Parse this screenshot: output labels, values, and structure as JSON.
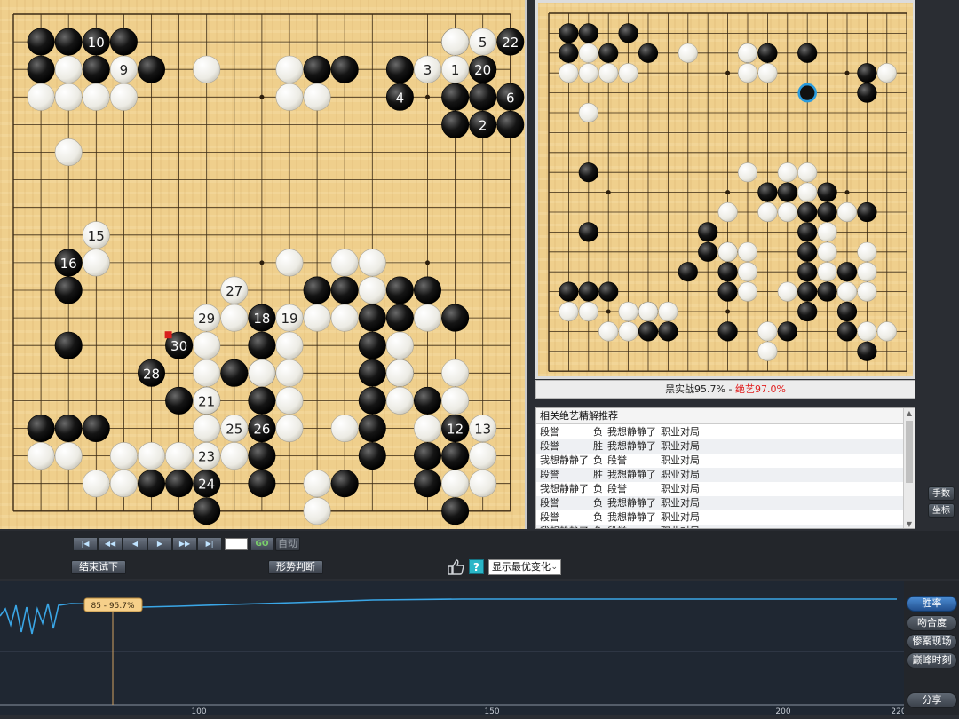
{
  "main_board": {
    "black": [
      [
        1,
        1
      ],
      [
        2,
        1
      ],
      [
        4,
        1
      ],
      [
        1,
        2
      ],
      [
        3,
        2
      ],
      [
        5,
        2
      ],
      [
        14,
        2
      ],
      [
        11,
        2
      ],
      [
        12,
        2
      ],
      [
        16,
        3
      ],
      [
        16,
        4
      ],
      [
        17,
        2
      ],
      [
        16,
        1
      ],
      [
        18,
        4
      ],
      [
        17,
        3
      ],
      [
        2,
        9
      ],
      [
        2,
        10
      ],
      [
        2,
        12
      ],
      [
        11,
        10
      ],
      [
        12,
        10
      ],
      [
        14,
        10
      ],
      [
        15,
        10
      ],
      [
        13,
        11
      ],
      [
        14,
        11
      ],
      [
        16,
        11
      ],
      [
        9,
        12
      ],
      [
        13,
        12
      ],
      [
        8,
        13
      ],
      [
        13,
        13
      ],
      [
        14,
        13
      ],
      [
        6,
        14
      ],
      [
        9,
        13
      ],
      [
        7,
        14
      ],
      [
        9,
        14
      ],
      [
        13,
        14
      ],
      [
        15,
        14
      ],
      [
        1,
        15
      ],
      [
        2,
        15
      ],
      [
        3,
        15
      ],
      [
        9,
        15
      ],
      [
        13,
        15
      ],
      [
        9,
        16
      ],
      [
        13,
        16
      ],
      [
        15,
        16
      ],
      [
        16,
        16
      ],
      [
        9,
        17
      ],
      [
        12,
        17
      ],
      [
        15,
        17
      ],
      [
        5,
        17
      ],
      [
        6,
        17
      ],
      [
        16,
        18
      ],
      [
        7,
        18
      ]
    ],
    "white": [
      [
        2,
        2
      ],
      [
        7,
        2
      ],
      [
        10,
        2
      ],
      [
        15,
        2
      ],
      [
        16,
        1
      ],
      [
        1,
        3
      ],
      [
        2,
        3
      ],
      [
        3,
        3
      ],
      [
        4,
        3
      ],
      [
        10,
        3
      ],
      [
        11,
        3
      ],
      [
        2,
        5
      ],
      [
        3,
        9
      ],
      [
        10,
        9
      ],
      [
        12,
        9
      ],
      [
        13,
        9
      ],
      [
        13,
        10
      ],
      [
        8,
        11
      ],
      [
        9,
        11
      ],
      [
        11,
        11
      ],
      [
        12,
        11
      ],
      [
        15,
        11
      ],
      [
        7,
        12
      ],
      [
        10,
        12
      ],
      [
        14,
        12
      ],
      [
        7,
        13
      ],
      [
        9,
        13
      ],
      [
        10,
        13
      ],
      [
        14,
        13
      ],
      [
        16,
        13
      ],
      [
        10,
        14
      ],
      [
        14,
        14
      ],
      [
        16,
        14
      ],
      [
        7,
        15
      ],
      [
        10,
        15
      ],
      [
        12,
        15
      ],
      [
        15,
        15
      ],
      [
        16,
        15
      ],
      [
        1,
        16
      ],
      [
        2,
        16
      ],
      [
        4,
        16
      ],
      [
        5,
        16
      ],
      [
        6,
        16
      ],
      [
        8,
        16
      ],
      [
        17,
        16
      ],
      [
        3,
        17
      ],
      [
        4,
        17
      ],
      [
        7,
        17
      ],
      [
        11,
        17
      ],
      [
        16,
        17
      ],
      [
        17,
        17
      ],
      [
        11,
        18
      ],
      [
        7,
        16
      ]
    ],
    "numbered": [
      {
        "n": "10",
        "x": 3,
        "y": 1,
        "c": "b"
      },
      {
        "n": "9",
        "x": 4,
        "y": 2,
        "c": "w"
      },
      {
        "n": "5",
        "x": 17,
        "y": 1,
        "c": "w"
      },
      {
        "n": "22",
        "x": 18,
        "y": 1,
        "c": "b"
      },
      {
        "n": "3",
        "x": 15,
        "y": 2,
        "c": "w"
      },
      {
        "n": "1",
        "x": 16,
        "y": 2,
        "c": "w"
      },
      {
        "n": "20",
        "x": 17,
        "y": 2,
        "c": "b"
      },
      {
        "n": "4",
        "x": 14,
        "y": 3,
        "c": "b"
      },
      {
        "n": "6",
        "x": 18,
        "y": 3,
        "c": "b"
      },
      {
        "n": "2",
        "x": 17,
        "y": 4,
        "c": "b"
      },
      {
        "n": "15",
        "x": 3,
        "y": 8,
        "c": "w"
      },
      {
        "n": "16",
        "x": 2,
        "y": 9,
        "c": "b"
      },
      {
        "n": "27",
        "x": 8,
        "y": 10,
        "c": "w"
      },
      {
        "n": "29",
        "x": 7,
        "y": 11,
        "c": "w"
      },
      {
        "n": "18",
        "x": 9,
        "y": 11,
        "c": "b"
      },
      {
        "n": "19",
        "x": 10,
        "y": 11,
        "c": "w"
      },
      {
        "n": "30",
        "x": 6,
        "y": 12,
        "c": "b"
      },
      {
        "n": "28",
        "x": 5,
        "y": 13,
        "c": "b"
      },
      {
        "n": "21",
        "x": 7,
        "y": 14,
        "c": "w"
      },
      {
        "n": "25",
        "x": 8,
        "y": 15,
        "c": "w"
      },
      {
        "n": "26",
        "x": 9,
        "y": 15,
        "c": "b"
      },
      {
        "n": "12",
        "x": 16,
        "y": 15,
        "c": "b"
      },
      {
        "n": "13",
        "x": 17,
        "y": 15,
        "c": "w"
      },
      {
        "n": "23",
        "x": 7,
        "y": 16,
        "c": "w"
      },
      {
        "n": "24",
        "x": 7,
        "y": 17,
        "c": "b"
      }
    ]
  },
  "mini_board": {
    "black": [
      [
        1,
        1
      ],
      [
        2,
        1
      ],
      [
        4,
        1
      ],
      [
        1,
        2
      ],
      [
        3,
        2
      ],
      [
        5,
        2
      ],
      [
        10,
        2
      ],
      [
        11,
        2
      ],
      [
        13,
        2
      ],
      [
        16,
        3
      ],
      [
        16,
        4
      ],
      [
        2,
        8
      ],
      [
        2,
        11
      ],
      [
        11,
        9
      ],
      [
        12,
        9
      ],
      [
        14,
        9
      ],
      [
        13,
        10
      ],
      [
        14,
        10
      ],
      [
        16,
        10
      ],
      [
        8,
        11
      ],
      [
        13,
        11
      ],
      [
        8,
        12
      ],
      [
        9,
        12
      ],
      [
        13,
        12
      ],
      [
        7,
        13
      ],
      [
        9,
        13
      ],
      [
        13,
        13
      ],
      [
        15,
        13
      ],
      [
        1,
        14
      ],
      [
        2,
        14
      ],
      [
        3,
        14
      ],
      [
        9,
        14
      ],
      [
        13,
        14
      ],
      [
        14,
        14
      ],
      [
        13,
        15
      ],
      [
        5,
        15
      ],
      [
        6,
        16
      ],
      [
        5,
        16
      ],
      [
        9,
        16
      ],
      [
        12,
        16
      ],
      [
        15,
        15
      ],
      [
        15,
        16
      ],
      [
        16,
        17
      ]
    ],
    "white": [
      [
        2,
        2
      ],
      [
        7,
        2
      ],
      [
        10,
        2
      ],
      [
        10,
        3
      ],
      [
        11,
        3
      ],
      [
        1,
        3
      ],
      [
        2,
        3
      ],
      [
        3,
        3
      ],
      [
        4,
        3
      ],
      [
        17,
        3
      ],
      [
        2,
        5
      ],
      [
        10,
        8
      ],
      [
        12,
        8
      ],
      [
        13,
        8
      ],
      [
        13,
        9
      ],
      [
        9,
        10
      ],
      [
        11,
        10
      ],
      [
        12,
        10
      ],
      [
        15,
        10
      ],
      [
        14,
        11
      ],
      [
        9,
        12
      ],
      [
        10,
        12
      ],
      [
        14,
        12
      ],
      [
        16,
        12
      ],
      [
        10,
        13
      ],
      [
        14,
        13
      ],
      [
        16,
        13
      ],
      [
        10,
        14
      ],
      [
        12,
        14
      ],
      [
        15,
        14
      ],
      [
        16,
        14
      ],
      [
        1,
        15
      ],
      [
        2,
        15
      ],
      [
        4,
        15
      ],
      [
        5,
        15
      ],
      [
        6,
        15
      ],
      [
        3,
        16
      ],
      [
        4,
        16
      ],
      [
        11,
        16
      ],
      [
        16,
        16
      ],
      [
        17,
        16
      ],
      [
        11,
        17
      ]
    ],
    "highlight": [
      13,
      4
    ]
  },
  "mini_caption": {
    "prefix": "黑实战95.7% - ",
    "highlight": "绝艺97.0%"
  },
  "list_panel": {
    "title": "相关绝艺精解推荐",
    "rows": [
      [
        "段誉",
        "负",
        "我想静静了",
        "职业对局"
      ],
      [
        "段誉",
        "胜",
        "我想静静了",
        "职业对局"
      ],
      [
        "我想静静了",
        "负",
        "段誉",
        "职业对局"
      ],
      [
        "段誉",
        "胜",
        "我想静静了",
        "职业对局"
      ],
      [
        "我想静静了",
        "负",
        "段誉",
        "职业对局"
      ],
      [
        "段誉",
        "负",
        "我想静静了",
        "职业对局"
      ],
      [
        "段誉",
        "负",
        "我想静静了",
        "职业对局"
      ],
      [
        "我想静静了",
        "负",
        "段誉",
        "职业对局"
      ],
      [
        "段誉",
        "胜",
        "我想静静了",
        "职业对局"
      ]
    ]
  },
  "side_buttons": {
    "moves": "手数",
    "coords": "坐标"
  },
  "toolbar": {
    "nav": [
      "|◀",
      "◀◀",
      "◀",
      "▶",
      "▶▶",
      "▶|"
    ],
    "go": "GO",
    "auto": "自动",
    "end_trial": "结束试下",
    "judge": "形势判断",
    "help": "?",
    "select_value": "显示最优变化"
  },
  "graph": {
    "tooltip": "85 - 95.7%",
    "x_ticks": [
      "100",
      "150",
      "200",
      "220"
    ],
    "line_color": "#3aa6e6"
  },
  "right_buttons": {
    "winrate": "胜率",
    "match": "吻合度",
    "disaster": "惨案现场",
    "peak": "巅峰时刻",
    "share": "分享"
  }
}
